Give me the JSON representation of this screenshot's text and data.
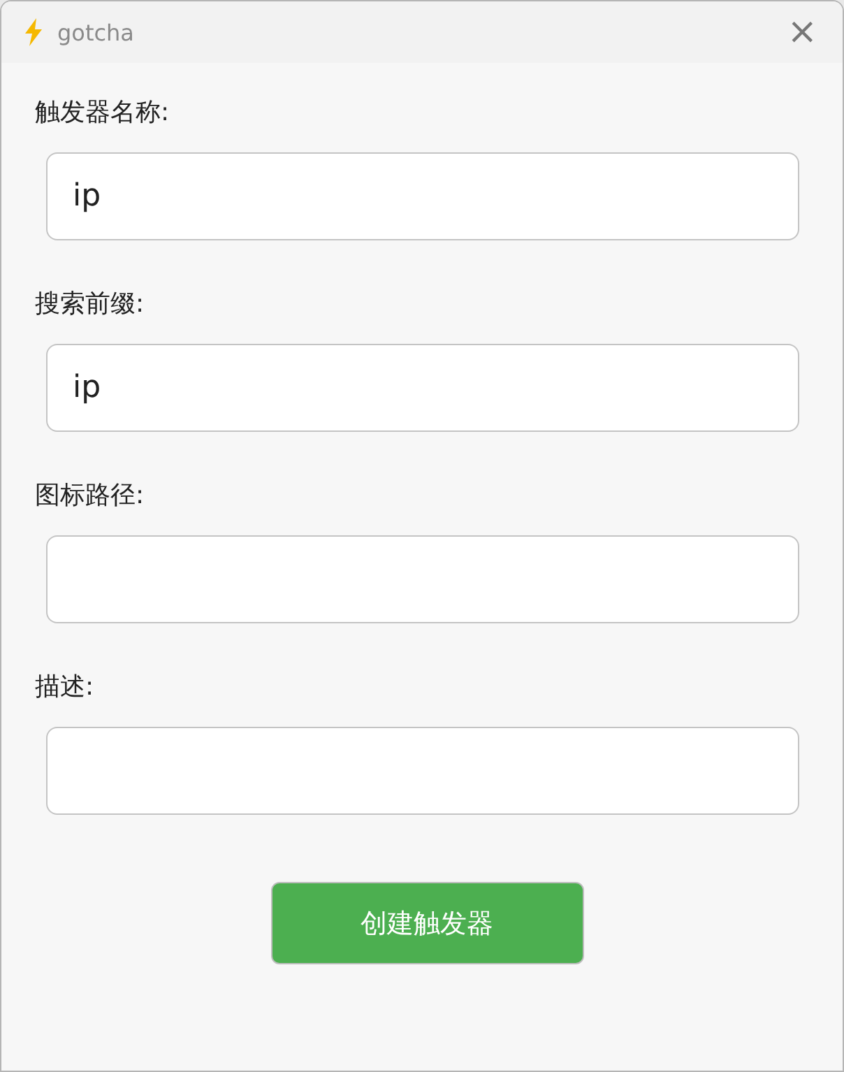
{
  "window": {
    "title": "gotcha",
    "close": "×"
  },
  "fields": [
    {
      "label": "触发器名称:",
      "value": "ip"
    },
    {
      "label": "搜索前缀:",
      "value": "ip"
    },
    {
      "label": "图标路径:"
    },
    {
      "label": "描述:"
    }
  ],
  "submit": "创建触发器"
}
